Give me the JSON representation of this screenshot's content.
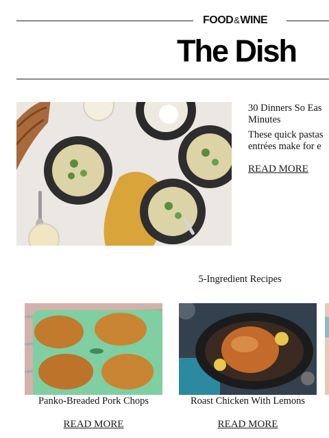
{
  "header": {
    "brand_food": "FOOD",
    "brand_amp": "&",
    "brand_wine": "WINE",
    "title": "The Dish"
  },
  "hero": {
    "title_line1": "30 Dinners So Eas",
    "title_line2": "Minutes",
    "desc_line1": "These quick pastas",
    "desc_line2": "entrées make for e",
    "read_more": "READ MORE"
  },
  "section": {
    "title": "5-Ingredient Recipes"
  },
  "cards": [
    {
      "title": "Panko-Breaded Pork Chops",
      "read_more": "READ MORE"
    },
    {
      "title": "Roast Chicken With Lemons",
      "read_more": "READ MORE"
    },
    {
      "title": "",
      "read_more": ""
    }
  ],
  "colors": {
    "text": "#111111",
    "rule": "#222222",
    "background": "#ffffff"
  }
}
